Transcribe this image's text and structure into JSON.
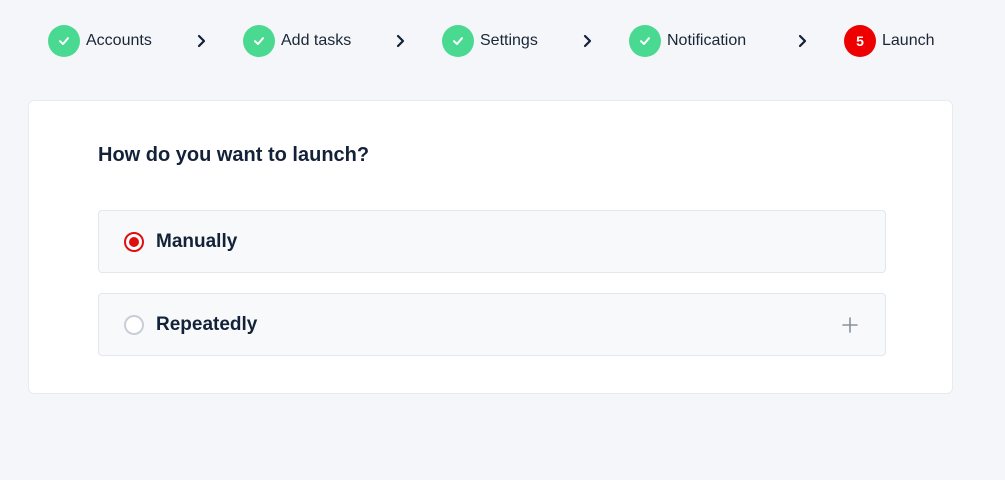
{
  "stepper": {
    "steps": [
      {
        "label": "Accounts",
        "status": "done",
        "icon": "check-icon"
      },
      {
        "label": "Add tasks",
        "status": "done",
        "icon": "check-icon"
      },
      {
        "label": "Settings",
        "status": "done",
        "icon": "check-icon"
      },
      {
        "label": "Notification",
        "status": "done",
        "icon": "check-icon"
      },
      {
        "label": "Launch",
        "status": "active",
        "number": "5"
      }
    ],
    "separator_icon": "chevron-right-icon",
    "colors": {
      "done": "#4ad991",
      "active": "#ee0000"
    }
  },
  "launch": {
    "question": "How do you want to launch?",
    "options": [
      {
        "label": "Manually",
        "selected": true
      },
      {
        "label": "Repeatedly",
        "selected": false,
        "expand_icon": "plus-icon"
      }
    ],
    "accent_color": "#dd0f0f"
  }
}
